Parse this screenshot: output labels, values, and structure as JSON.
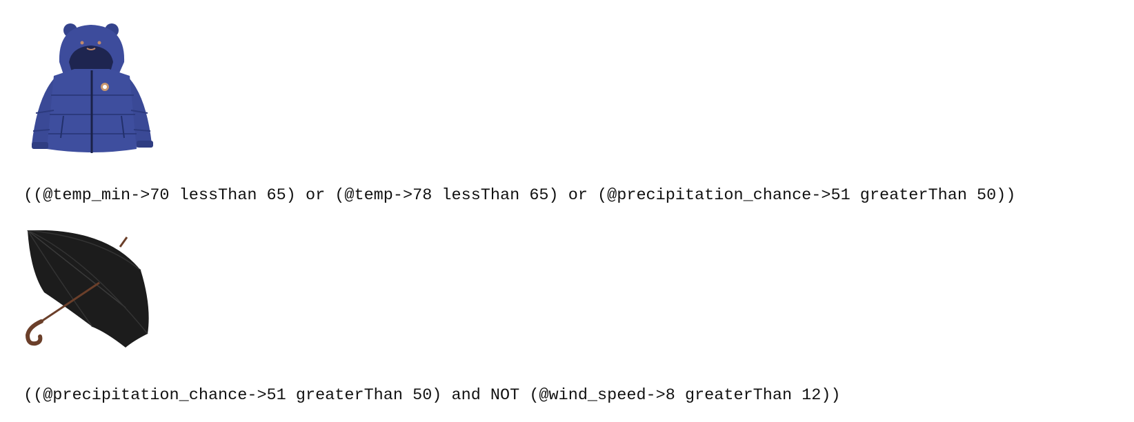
{
  "items": [
    {
      "icon": "jacket-icon",
      "rule": "((@temp_min->70 lessThan 65) or (@temp->78 lessThan 65) or (@precipitation_chance->51 greaterThan 50))"
    },
    {
      "icon": "umbrella-icon",
      "rule": "((@precipitation_chance->51 greaterThan 50) and NOT (@wind_speed->8 greaterThan 12))"
    }
  ],
  "colors": {
    "jacket": "#3b4a98",
    "umbrella": "#1a1a1a",
    "handle": "#6b3f2a"
  }
}
